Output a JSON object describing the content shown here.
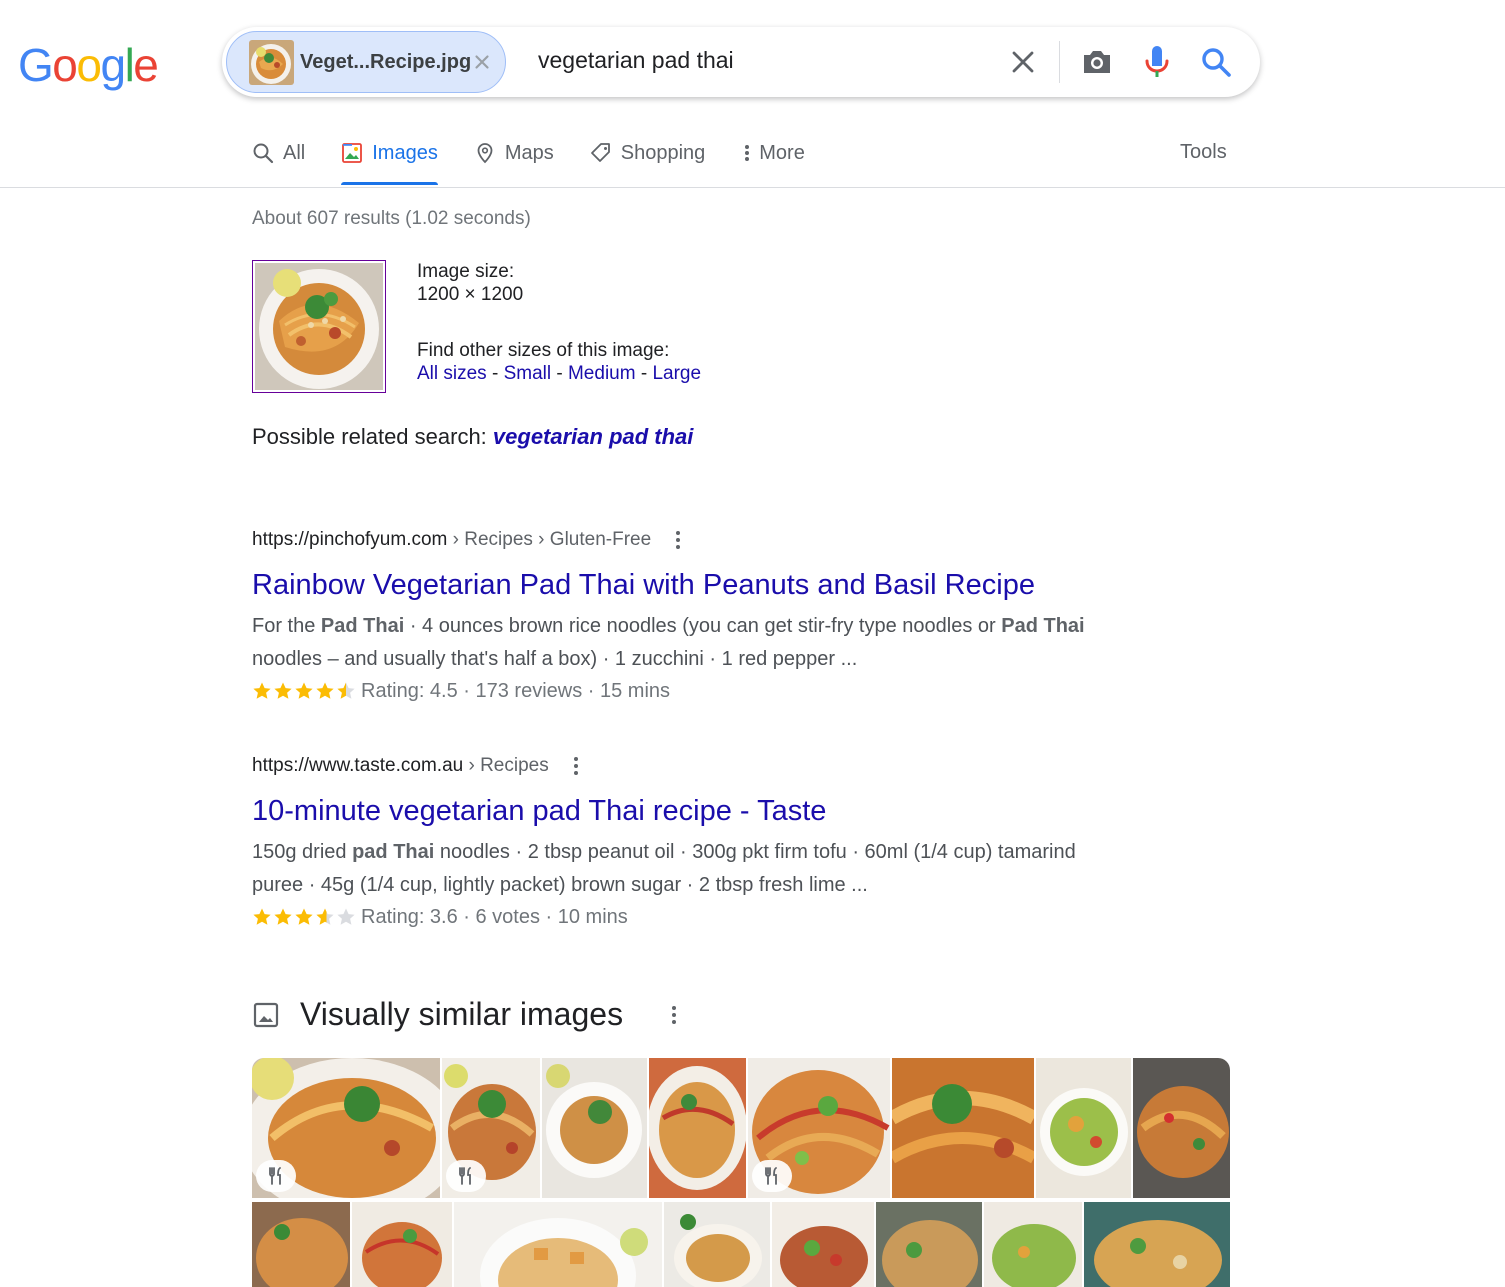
{
  "logo": {
    "text": "Google",
    "letters": [
      "G",
      "o",
      "o",
      "g",
      "l",
      "e"
    ],
    "colors": [
      "#4285F4",
      "#EA4335",
      "#FBBC05",
      "#4285F4",
      "#34A853",
      "#EA4335"
    ]
  },
  "search": {
    "chip_label": "Veget...Recipe.jpg",
    "query": "vegetarian pad thai",
    "icons": [
      "close-icon",
      "camera-icon",
      "microphone-icon",
      "search-icon"
    ]
  },
  "tabs": [
    {
      "label": "All",
      "icon": "search-icon",
      "active": false
    },
    {
      "label": "Images",
      "icon": "image-icon",
      "active": true
    },
    {
      "label": "Maps",
      "icon": "map-pin-icon",
      "active": false
    },
    {
      "label": "Shopping",
      "icon": "tag-icon",
      "active": false
    },
    {
      "label": "More",
      "icon": "more-vert-icon",
      "active": false
    }
  ],
  "tools_label": "Tools",
  "stats": "About 607 results (1.02 seconds)",
  "image_info": {
    "size_label": "Image size:",
    "size_value": "1200 × 1200",
    "other_sizes_label": "Find other sizes of this image:",
    "sizes": [
      "All sizes",
      "Small",
      "Medium",
      "Large"
    ],
    "separator": " - "
  },
  "related": {
    "label": "Possible related search: ",
    "link": "vegetarian pad thai"
  },
  "results": [
    {
      "url": "https://pinchofyum.com",
      "crumbs": " › Recipes › Gluten-Free",
      "title": "Rainbow Vegetarian Pad Thai with Peanuts and Basil Recipe",
      "snippet_line1": [
        "For the ",
        "Pad Thai",
        " · 4 ounces brown rice noodles (you can get stir-fry type noodles or ",
        "Pad Thai"
      ],
      "snippet_line2": "noodles – and usually that's half a box) · 1 zucchini · 1 red pepper ...",
      "rating_value": 4.5,
      "rating_text": "Rating: 4.5 · 173 reviews · 15 mins"
    },
    {
      "url": "https://www.taste.com.au",
      "crumbs": " › Recipes",
      "title": "10-minute vegetarian pad Thai recipe - Taste",
      "snippet_line1": [
        "150g dried ",
        "pad Thai",
        " noodles · 2 tbsp peanut oil · 300g pkt firm tofu · 60ml (1/4 cup) tamarind"
      ],
      "snippet_line2": "puree · 45g (1/4 cup, lightly packet) brown sugar · 2 tbsp fresh lime ...",
      "rating_value": 3.6,
      "rating_text": "Rating: 3.6 · 6 votes · 10 mins"
    }
  ],
  "visually_similar": {
    "title": "Visually similar images",
    "icon": "image-icon"
  },
  "colors": {
    "link": "#1a0dab",
    "accent": "#1a73e8",
    "star": "#fbbc04",
    "star_empty": "#dadce0"
  }
}
